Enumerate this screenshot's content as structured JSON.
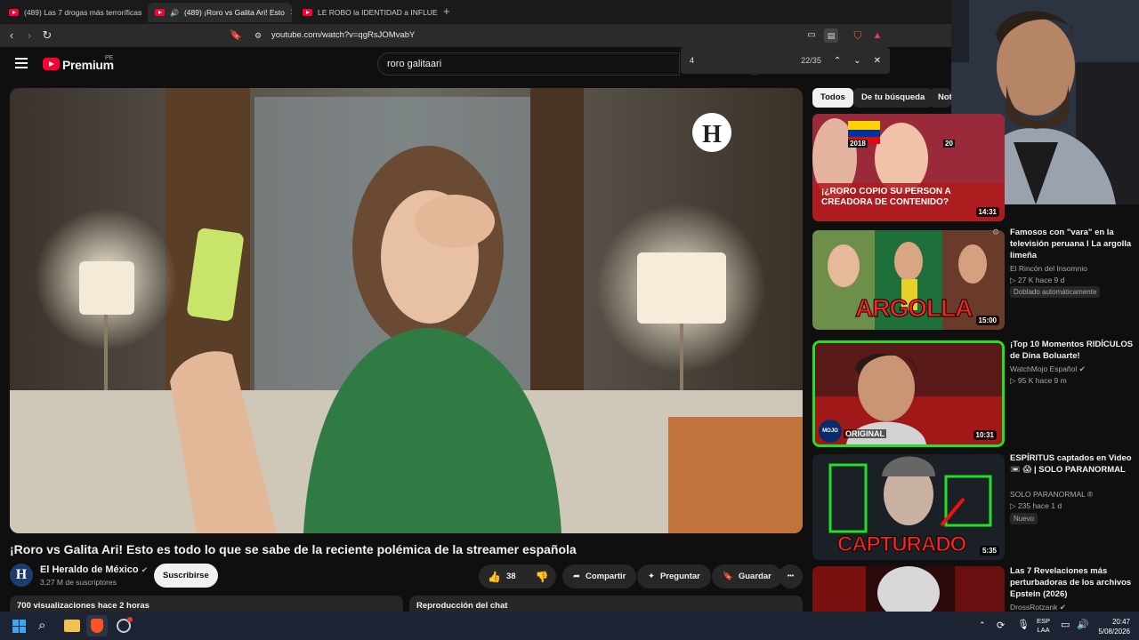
{
  "browser": {
    "tabs": [
      {
        "label": "(489) Las 7 drogas más terroríficas de",
        "active": false
      },
      {
        "label": "(489) ¡Roro vs Galita Ari! Esto",
        "active": true
      },
      {
        "label": "LE ROBO la IDENTIDAD a INFLUENCE",
        "active": false
      }
    ],
    "new_tab": "+",
    "url": "youtube.com/watch?v=qgRsJOMvabY"
  },
  "youtube": {
    "logo_text": "Premium",
    "region": "PE",
    "search_value": "roro galitaari",
    "find": {
      "query": "4",
      "count": "22/35"
    }
  },
  "video": {
    "title": "¡Roro vs Galita Ari! Esto es todo lo que se sabe de la reciente polémica de la streamer española",
    "channel_logo_letter": "H",
    "watermark_letter": "H",
    "channel": "El Heraldo de México",
    "subscribers": "3,27 M de suscriptores",
    "subscribe": "Suscribirse",
    "likes": "38",
    "share": "Compartir",
    "ask": "Preguntar",
    "save": "Guardar",
    "more": "•••",
    "description_meta": "700 visualizaciones  hace 2 horas",
    "chat_replay": "Reproducción del chat"
  },
  "sidebar": {
    "chips": [
      "Todos",
      "De tu búsqueda",
      "Not"
    ],
    "videos": [
      {
        "thumb_text": "¡¿RORO COPIO SU PERSON A CREADORA DE CONTENIDO?",
        "year_left": "2018",
        "year_right": "20",
        "duration": "14:31",
        "title": "",
        "channel": "",
        "meta": ""
      },
      {
        "thumb_text": "ARGOLLA",
        "duration": "15:00",
        "title": "Famosos con \"vara\" en la televisión peruana I La argolla limeña",
        "channel": "El Rincón del Insomnio",
        "meta": "▷ 27 K   hace 9 d",
        "badge": "Doblado automáticamente"
      },
      {
        "thumb_text": "ORIGINAL",
        "logo_text": "MOJO",
        "duration": "10:31",
        "title": "¡Top 10 Momentos RIDÍCULOS de Dina Boluarte!",
        "channel": "WatchMojo Español",
        "meta": "▷ 95 K   hace 9 m"
      },
      {
        "thumb_text": "CAPTURADO",
        "duration": "5:35",
        "title": "ESPÍRITUS captados en Video 📼 😱 | SOLO PARANORMAL",
        "channel": "SOLO PARANORMAL ®",
        "meta": "▷ 235   hace 1 d",
        "badge": "Nuevo"
      },
      {
        "thumb_text": "",
        "duration": "",
        "title": "Las 7 Revelaciones más perturbadoras de los archivos Epstein (2026)",
        "channel": "DrossRotzank",
        "meta": ""
      }
    ]
  },
  "taskbar": {
    "lang_top": "ESP",
    "lang_bottom": "LAA",
    "time": "20:47",
    "date": "5/08/2026"
  },
  "colors": {
    "yt_red": "#ff0033",
    "highlight_green": "#22e022",
    "bg": "#0f0f0f"
  }
}
